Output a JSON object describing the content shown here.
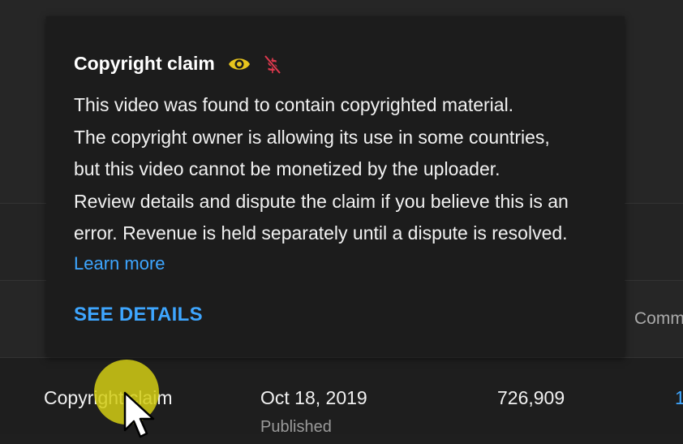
{
  "table": {
    "header_comments": "Comm",
    "row": {
      "restrictions": "Copyright claim",
      "date": "Oct 18, 2019",
      "date_status": "Published",
      "views": "726,909",
      "comments_partial": "1"
    }
  },
  "tooltip": {
    "title": "Copyright claim",
    "icons": [
      "eye-icon",
      "no-money-icon"
    ],
    "lines": [
      "This video was found to contain copyrighted material.",
      "The copyright owner is allowing its use in some countries,",
      "but this video cannot be monetized by the uploader.",
      "Review details and dispute the claim if you believe this is an",
      "error. Revenue is held separately until a dispute is resolved."
    ],
    "learn_more": "Learn more",
    "see_details": "SEE DETAILS"
  },
  "colors": {
    "accent_link": "#3ea6ff",
    "eye_icon": "#e8c51d",
    "money_icon": "#e0394e",
    "cursor_highlight": "#d4ce14"
  }
}
